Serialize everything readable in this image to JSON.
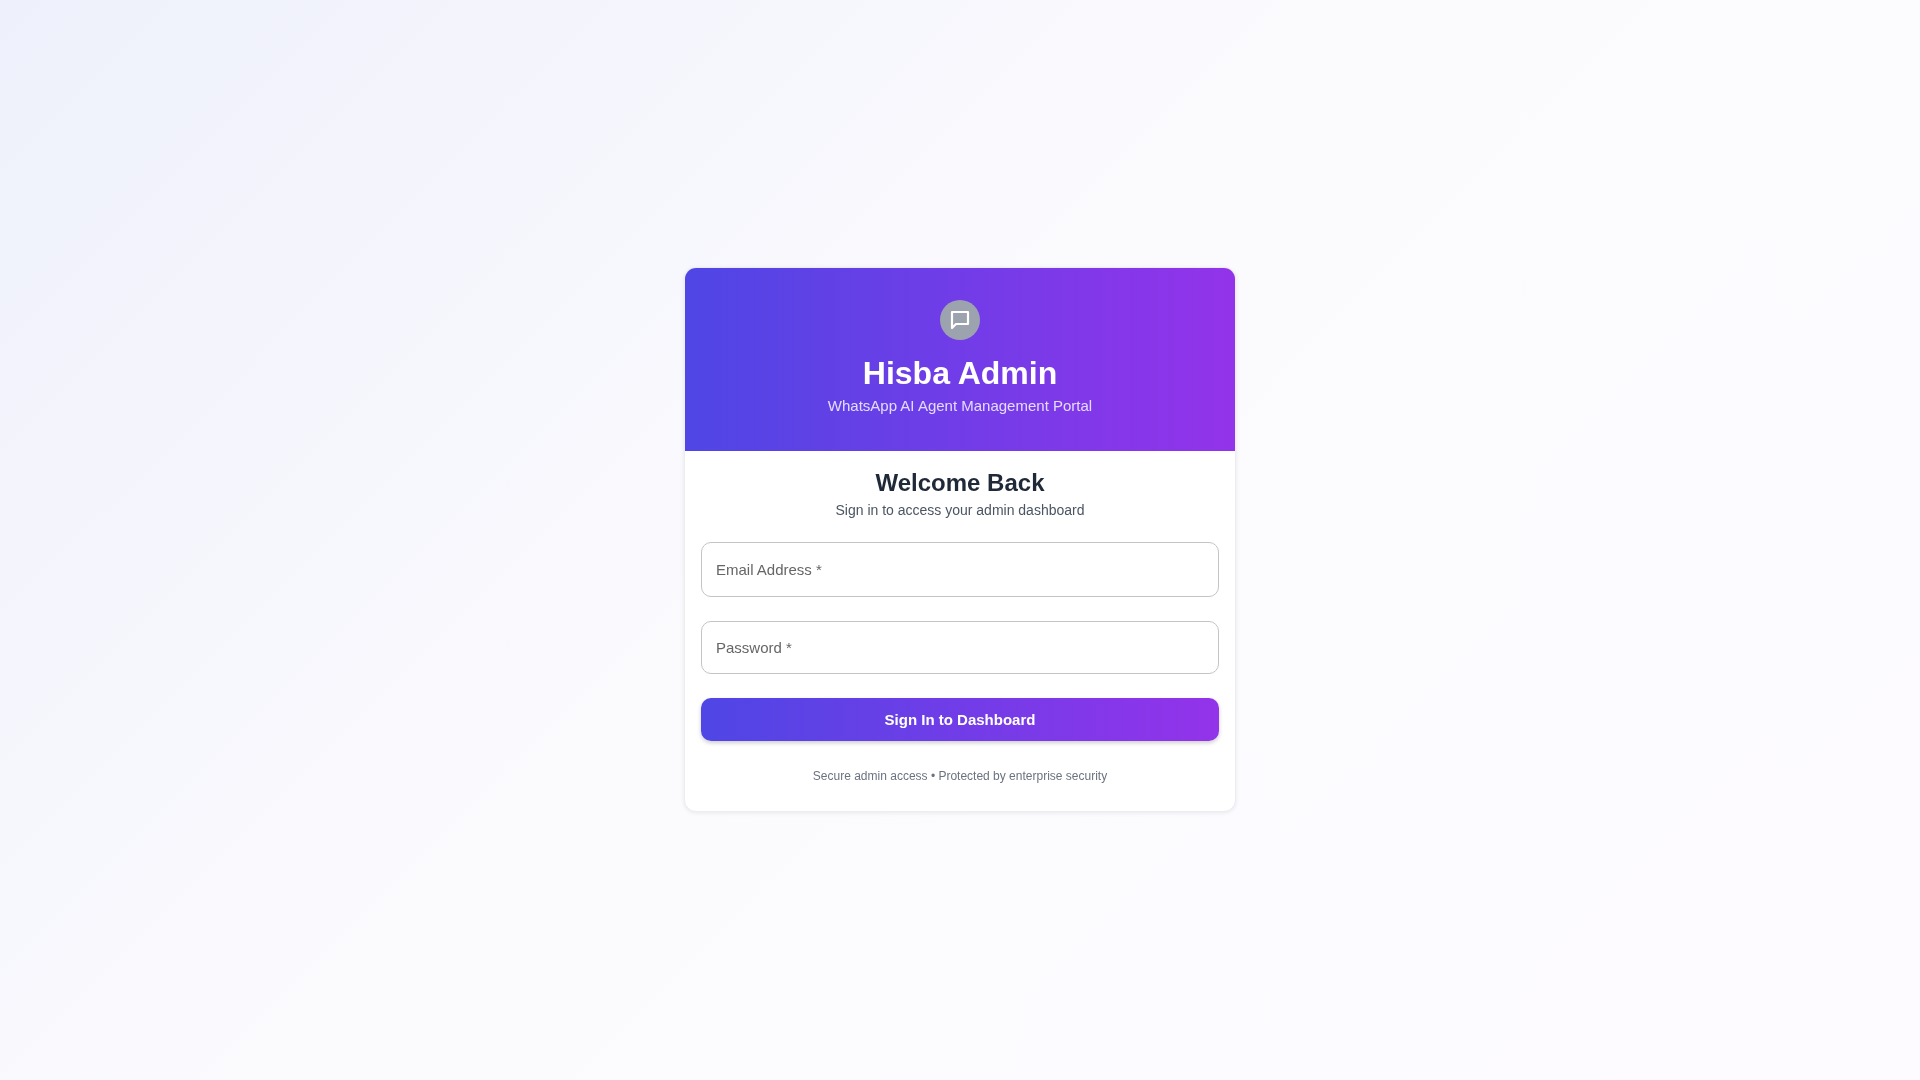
{
  "header": {
    "title": "Hisba Admin",
    "subtitle": "WhatsApp AI Agent Management Portal"
  },
  "welcome": {
    "title": "Welcome Back",
    "subtitle": "Sign in to access your admin dashboard"
  },
  "fields": [
    {
      "placeholder": "Email Address *"
    },
    {
      "placeholder": "Password *"
    }
  ],
  "submit_button": "Sign In to Dashboard",
  "footer": "Secure admin access • Protected by enterprise security"
}
